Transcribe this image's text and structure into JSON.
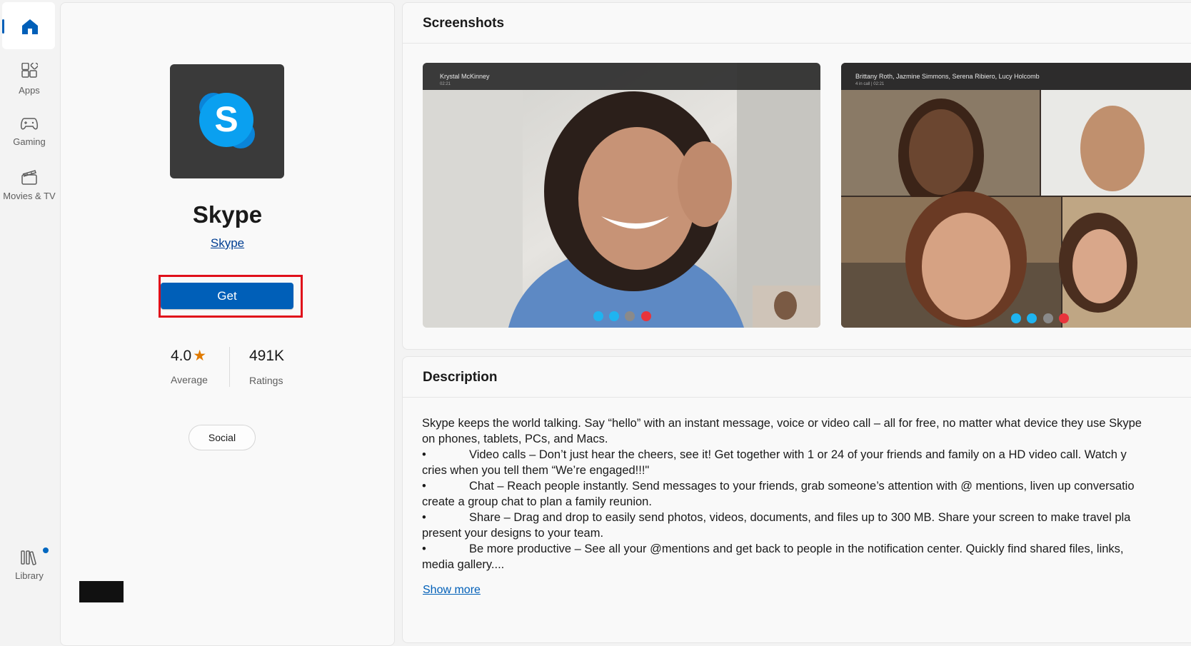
{
  "nav": {
    "items": [
      {
        "label": ""
      },
      {
        "label": "Apps"
      },
      {
        "label": "Gaming"
      },
      {
        "label": "Movies & TV"
      }
    ],
    "library_label": "Library"
  },
  "app": {
    "name": "Skype",
    "publisher": "Skype",
    "get_label": "Get",
    "rating_value": "4.0",
    "rating_label": "Average",
    "ratings_count": "491K",
    "ratings_label": "Ratings",
    "category": "Social"
  },
  "screenshots": {
    "title": "Screenshots",
    "items": [
      {
        "caller": "Krystal McKinney",
        "sub": "02:21"
      },
      {
        "caller": "Brittany Roth, Jazmine Simmons, Serena Ribiero, Lucy Holcomb",
        "sub": "4 in call | 02:21"
      }
    ]
  },
  "description": {
    "title": "Description",
    "lines": [
      {
        "bullet": "",
        "text": "Skype keeps the world talking. Say “hello” with an instant message, voice or video call – all for free, no matter what device they use Skype"
      },
      {
        "bullet": "",
        "text": "on phones, tablets, PCs, and Macs."
      },
      {
        "bullet": "•",
        "text": "Video calls – Don’t just hear the cheers, see it! Get together with 1 or 24 of your friends and family on a HD video call. Watch y"
      },
      {
        "bullet": "",
        "text": "cries when you tell them “We’re engaged!!!\""
      },
      {
        "bullet": "•",
        "text": "Chat – Reach people instantly. Send messages to your friends, grab someone’s attention with @ mentions, liven up conversatio"
      },
      {
        "bullet": "",
        "text": "create a group chat to plan a family reunion."
      },
      {
        "bullet": "•",
        "text": "Share – Drag and drop to easily send photos, videos, documents, and files up to 300 MB. Share your screen to make travel pla"
      },
      {
        "bullet": "",
        "text": "present your designs to your team."
      },
      {
        "bullet": "•",
        "text": "Be more productive – See all your @mentions and get back to people in the notification center. Quickly find shared files, links,"
      },
      {
        "bullet": "",
        "text": "media gallery...."
      }
    ],
    "show_more": "Show more"
  },
  "colors": {
    "accent": "#005fb8",
    "highlight_box": "#e0101b",
    "star": "#e07a00",
    "skype_blue": "#0aa0f0"
  },
  "icons": [
    "home-icon",
    "apps-icon",
    "gaming-icon",
    "movies-tv-icon",
    "library-icon",
    "skype-logo-icon",
    "star-icon"
  ]
}
